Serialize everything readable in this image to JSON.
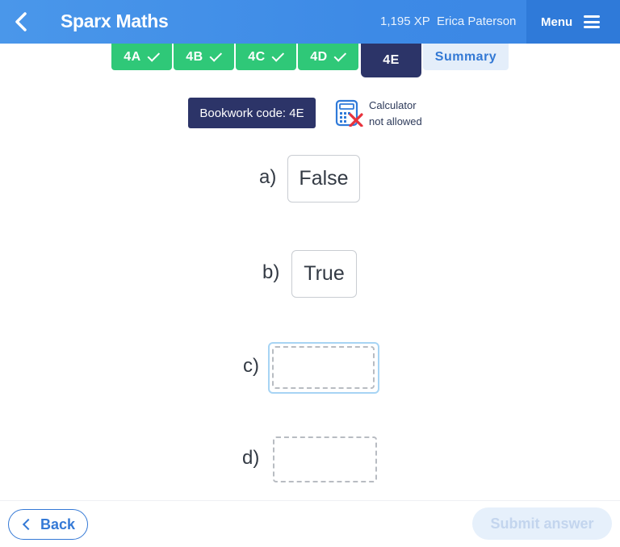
{
  "header": {
    "app_title": "Sparx Maths",
    "xp": "1,195 XP",
    "user_name": "Erica Paterson",
    "menu_label": "Menu"
  },
  "tabs": [
    {
      "label": "4A",
      "state": "complete"
    },
    {
      "label": "4B",
      "state": "complete"
    },
    {
      "label": "4C",
      "state": "complete"
    },
    {
      "label": "4D",
      "state": "complete"
    },
    {
      "label": "4E",
      "state": "active"
    },
    {
      "label": "Summary",
      "state": "summary"
    }
  ],
  "bookwork": {
    "code_text": "Bookwork code: 4E",
    "calculator_line1": "Calculator",
    "calculator_line2": "not allowed"
  },
  "questions": [
    {
      "label": "a)",
      "answer": "False"
    },
    {
      "label": "b)",
      "answer": "True"
    },
    {
      "label": "c)",
      "answer": ""
    },
    {
      "label": "d)",
      "answer": ""
    }
  ],
  "footer": {
    "back_label": "Back",
    "submit_label": "Submit answer"
  },
  "colors": {
    "header_blue": "#3d8ae6",
    "complete_green": "#2fc878",
    "active_navy": "#2c3468",
    "focus_ring": "#a7d4f4",
    "calc_red": "#e8323c"
  }
}
